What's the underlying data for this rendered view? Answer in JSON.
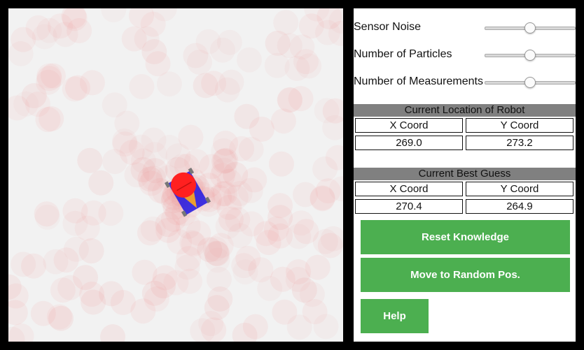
{
  "controls": {
    "sliders": [
      {
        "label": "Sensor Noise",
        "value": 0.5
      },
      {
        "label": "Number of Particles",
        "value": 0.5
      },
      {
        "label": "Number of Measurements",
        "value": 0.5
      }
    ]
  },
  "robot_location": {
    "title": "Current Location of Robot",
    "x_header": "X Coord",
    "y_header": "Y Coord",
    "x_value": "269.0",
    "y_value": "273.2"
  },
  "best_guess": {
    "title": "Current Best Guess",
    "x_header": "X Coord",
    "y_header": "Y Coord",
    "x_value": "270.4",
    "y_value": "264.9"
  },
  "buttons": {
    "reset": "Reset Knowledge",
    "move": "Move to Random Pos.",
    "help": "Help"
  },
  "colors": {
    "particle": "#f08080",
    "robot_body": "#2a1fe0",
    "robot_sensor": "#ff2020",
    "robot_cone": "#f5a623",
    "button": "#4caf50"
  }
}
